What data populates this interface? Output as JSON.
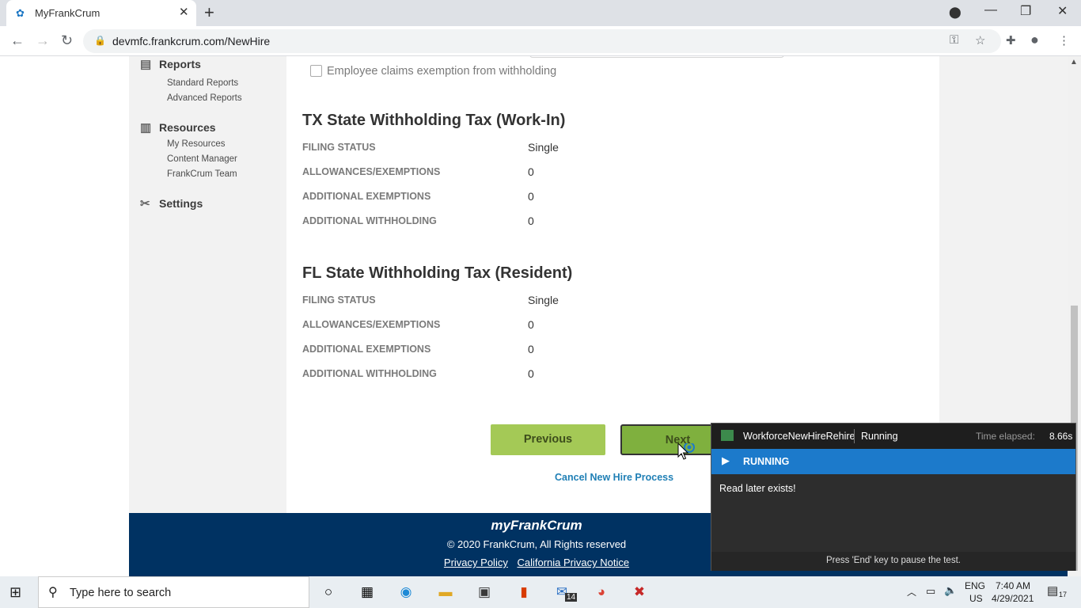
{
  "browser": {
    "tab_title": "MyFrankCrum",
    "url": "devmfc.frankcrum.com/NewHire"
  },
  "sidebar": {
    "reports": {
      "label": "Reports",
      "items": [
        "Standard Reports",
        "Advanced Reports"
      ]
    },
    "resources": {
      "label": "Resources",
      "items": [
        "My Resources",
        "Content Manager",
        "FrankCrum Team"
      ]
    },
    "settings": {
      "label": "Settings"
    }
  },
  "main": {
    "exempt_label": "Employee claims exemption from withholding",
    "tx": {
      "title": "TX State Withholding Tax (Work-In)",
      "rows": [
        {
          "label": "FILING STATUS",
          "value": "Single"
        },
        {
          "label": "ALLOWANCES/EXEMPTIONS",
          "value": "0"
        },
        {
          "label": "ADDITIONAL EXEMPTIONS",
          "value": "0"
        },
        {
          "label": "ADDITIONAL WITHHOLDING",
          "value": "0"
        }
      ]
    },
    "fl": {
      "title": "FL State Withholding Tax (Resident)",
      "rows": [
        {
          "label": "FILING STATUS",
          "value": "Single"
        },
        {
          "label": "ALLOWANCES/EXEMPTIONS",
          "value": "0"
        },
        {
          "label": "ADDITIONAL EXEMPTIONS",
          "value": "0"
        },
        {
          "label": "ADDITIONAL WITHHOLDING",
          "value": "0"
        }
      ]
    },
    "previous_label": "Previous",
    "next_label": "Next",
    "cancel_label": "Cancel New Hire Process"
  },
  "footer": {
    "logo": "myFrankCrum",
    "copyright": "© 2020 FrankCrum, All Rights reserved",
    "privacy": "Privacy Policy",
    "ca_privacy": "California Privacy Notice"
  },
  "runner": {
    "test_name": "WorkforceNewHireRehire",
    "state": "Running",
    "elapsed_label": "Time elapsed:",
    "elapsed_value": "8.66s",
    "banner": "RUNNING",
    "message": "Read later exists!",
    "hint": "Press 'End' key to pause the test."
  },
  "taskbar": {
    "search_placeholder": "Type here to search",
    "mail_badge": "14",
    "lang": "ENG",
    "region": "US",
    "time": "7:40 AM",
    "date": "4/29/2021",
    "notif_count": "17"
  }
}
